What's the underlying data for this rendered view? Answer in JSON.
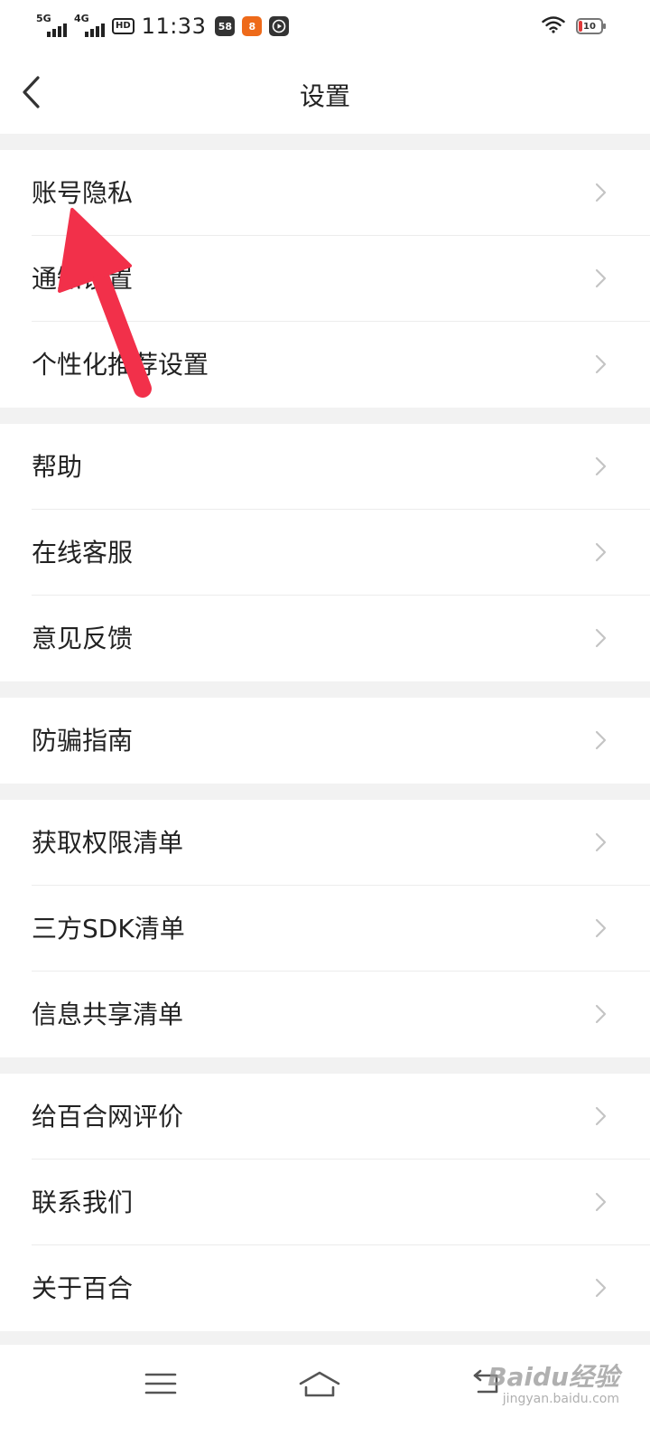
{
  "status_bar": {
    "signal_1": "5G",
    "signal_2": "4G",
    "hd_badge": "HD",
    "time": "11:33",
    "app_badge_1": "58",
    "app_badge_2": "8",
    "battery_level": "10",
    "battery_color": "#e03b3b"
  },
  "header": {
    "title": "设置",
    "back_icon": "chevron-left-icon"
  },
  "sections": [
    {
      "items": [
        {
          "label": "账号隐私"
        },
        {
          "label": "通知设置"
        },
        {
          "label": "个性化推荐设置"
        }
      ]
    },
    {
      "items": [
        {
          "label": "帮助"
        },
        {
          "label": "在线客服"
        },
        {
          "label": "意见反馈"
        }
      ]
    },
    {
      "items": [
        {
          "label": "防骗指南"
        }
      ]
    },
    {
      "items": [
        {
          "label": "获取权限清单"
        },
        {
          "label": "三方SDK清单"
        },
        {
          "label": "信息共享清单"
        }
      ]
    },
    {
      "items": [
        {
          "label": "给百合网评价"
        },
        {
          "label": "联系我们"
        },
        {
          "label": "关于百合"
        }
      ]
    }
  ],
  "nav_bar": {
    "menu_icon": "menu-icon",
    "home_icon": "home-icon",
    "back_icon": "back-icon"
  },
  "watermark": {
    "brand": "Baidu经验",
    "url": "jingyan.baidu.com"
  },
  "annotation": {
    "arrow_color": "#f2304a",
    "points_to": "账号隐私"
  }
}
